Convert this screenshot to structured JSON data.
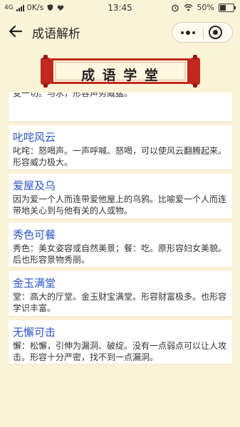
{
  "status_bar": {
    "network": "4G",
    "speed": "0K/s",
    "time": "13:45",
    "battery": "50%",
    "battery_level": 0.5
  },
  "nav": {
    "title": "成语解析"
  },
  "banner": {
    "text": "成 语 学 堂"
  },
  "idioms": [
    {
      "word": "",
      "desc": "变一切。与水，形容声势威猛。"
    },
    {
      "word": "叱咤风云",
      "desc": "叱咤：怒喝声。一声呼喊、怒喝，可以使风云翻腾起来。形容威力极大。"
    },
    {
      "word": "爱屋及乌",
      "desc": "因为爱一个人而连带爱他屋上的乌鸦。比喻爱一个人而连带地关心到与他有关的人或物。"
    },
    {
      "word": "秀色可餐",
      "desc": "秀色：美女姿容或自然美景；餐：吃。原形容妇女美貌。后也形容景物秀丽。"
    },
    {
      "word": "金玉满堂",
      "desc": "堂：高大的厅堂。金玉财宝满堂。形容财富极多。也形容学识丰富。"
    },
    {
      "word": "无懈可击",
      "desc": "懈：松懈，引伸为漏洞、破绽。没有一点弱点可以让人攻击。形容十分严密，找不到一点漏洞。"
    }
  ],
  "colors": {
    "background": "#fbf3d8",
    "card": "#ffffff",
    "word": "#2d56c7",
    "banner_red": "#c0281e",
    "banner_paper": "#fff7df"
  }
}
